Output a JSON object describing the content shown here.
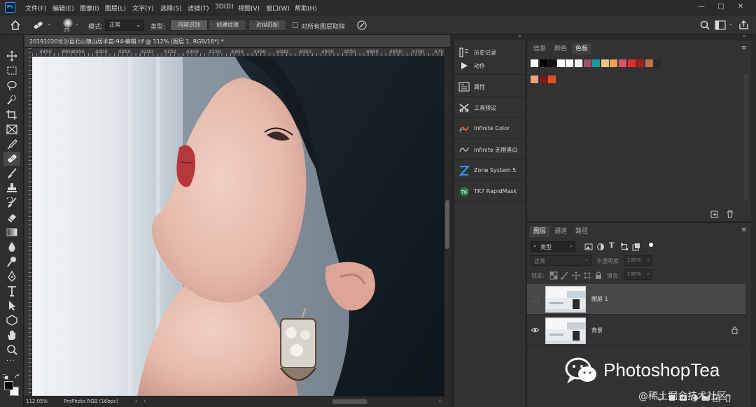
{
  "menubar": {
    "logo": "Ps",
    "items": [
      "文件(F)",
      "编辑(E)",
      "图像(I)",
      "图层(L)",
      "文字(Y)",
      "选择(S)",
      "滤镜(T)",
      "3D(D)",
      "视图(V)",
      "窗口(W)",
      "帮助(H)"
    ],
    "window_buttons": [
      "—",
      "□",
      "✕"
    ]
  },
  "options": {
    "brush_size": "25",
    "mode_label": "模式:",
    "mode_value": "正常",
    "type_label": "类型:",
    "type_options": [
      "内容识别",
      "创建纹理",
      "近似匹配"
    ],
    "sample_all_label": "对所有图层取样"
  },
  "document": {
    "tab_title": "20191020长沙县北山镇山居半亩-94-编辑.tif @ 112% (图层 1, RGB/16*) *",
    "ruler_ticks": [
      "3850",
      "3900",
      "3950",
      "4000",
      "4050",
      "4100",
      "4150",
      "4200",
      "4250",
      "4300",
      "4350",
      "4400",
      "4450",
      "4500",
      "4550",
      "4600",
      "4650",
      "4700",
      "475"
    ],
    "zoom": "112.05%",
    "color_profile": "ProPhoto RGB (16bpc)"
  },
  "dock": {
    "items": [
      {
        "label": "历史记录",
        "icon": "history-icon"
      },
      {
        "label": "动作",
        "icon": "play-icon"
      },
      {
        "label": "属性",
        "icon": "properties-icon"
      },
      {
        "label": "工具预设",
        "icon": "tool-presets-icon"
      },
      {
        "label": "Infinite Color",
        "icon": "infinite-color-icon"
      },
      {
        "label": "Infinite 无限黑白",
        "icon": "infinite-bw-icon"
      },
      {
        "label": "Zone System 5",
        "icon": "zone-system-icon"
      },
      {
        "label": "TK7 RapidMask",
        "icon": "tk7-icon"
      }
    ]
  },
  "swatches_panel": {
    "tabs": [
      "信息",
      "颜色",
      "色板"
    ],
    "active_tab": "色板",
    "row1": [
      "#ffffff",
      "#000000",
      "#111111",
      "#ffffff",
      "#ffffff",
      "#f0f0f0",
      "#a0506a",
      "#1a9aa0",
      "#f5c080",
      "#f0a050",
      "#e05060",
      "#e03030",
      "#a02020",
      "#c07050",
      "#2a2a2a"
    ],
    "row2": [
      "#f0a080",
      "#801818",
      "#e05020"
    ]
  },
  "layers_panel": {
    "tabs": [
      "图层",
      "通道",
      "路径"
    ],
    "active_tab": "图层",
    "filter_kind": "类型",
    "blend_mode": "正常",
    "opacity_label": "不透明度:",
    "opacity_value": "100%",
    "lock_label": "锁定:",
    "fill_label": "填充:",
    "fill_value": "100%",
    "layers": [
      {
        "name": "图层 1",
        "visible": false,
        "selected": true
      },
      {
        "name": "背景",
        "visible": true,
        "selected": false,
        "locked": true
      }
    ]
  },
  "watermark": {
    "brand": "PhotoshopTea",
    "site": "@稀土掘金技术社区"
  }
}
